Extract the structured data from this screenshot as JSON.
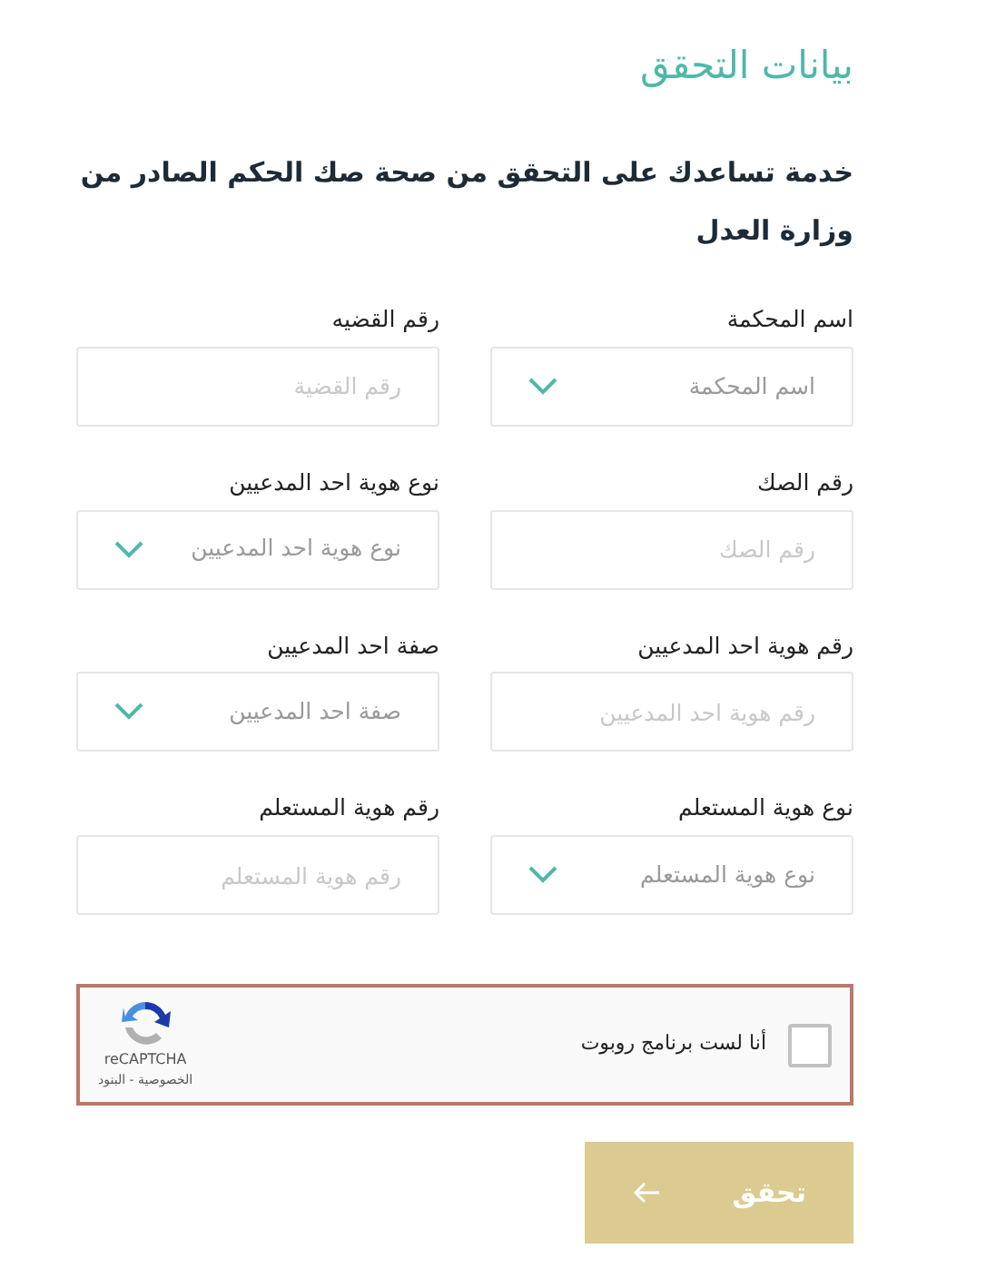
{
  "heading": "بيانات التحقق",
  "description": "خدمة تساعدك على التحقق من صحة صك الحكم الصادر من وزارة العدل",
  "fields": [
    {
      "kind": "select",
      "label": "اسم المحكمة",
      "placeholder": "اسم المحكمة"
    },
    {
      "kind": "input",
      "label": "رقم القضيه",
      "placeholder": "رقم القضية"
    },
    {
      "kind": "input",
      "label": "رقم الصك",
      "placeholder": "رقم الصك"
    },
    {
      "kind": "select",
      "label": "نوع هوية احد المدعيين",
      "placeholder": "نوع هوية احد المدعيين"
    },
    {
      "kind": "input",
      "label": "رقم هوية احد المدعيين",
      "placeholder": "رقم هوية احد المدعيين"
    },
    {
      "kind": "select",
      "label": "صفة احد المدعيين",
      "placeholder": "صفة احد المدعيين"
    },
    {
      "kind": "select",
      "label": "نوع هوية المستعلم",
      "placeholder": "نوع هوية المستعلم"
    },
    {
      "kind": "input",
      "label": "رقم هوية المستعلم",
      "placeholder": "رقم هوية المستعلم"
    }
  ],
  "captcha": {
    "label": "أنا لست برنامج روبوت",
    "checked": false,
    "brand": "reCAPTCHA",
    "links": "الخصوصية - البنود"
  },
  "submit": {
    "label": "تحقق",
    "disabled": true
  }
}
